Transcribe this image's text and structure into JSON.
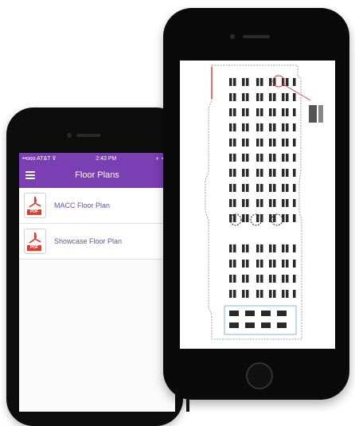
{
  "back_phone": {
    "status_bar": {
      "carrier": "••ooo AT&T ⊽",
      "time": "2:43 PM",
      "indicators": "◐ ⊲ ✱"
    },
    "nav": {
      "title": "Floor Plans",
      "menu_icon": "hamburger-icon"
    },
    "items": [
      {
        "label": "MACC Floor Plan",
        "icon": "pdf-icon",
        "tag": "PDF"
      },
      {
        "label": "Showcase Floor Plan",
        "icon": "pdf-icon",
        "tag": "PDF"
      }
    ]
  },
  "front_phone": {
    "content": "floor-plan-drawing"
  },
  "colors": {
    "purple": "#7a3fb2",
    "pdf_red": "#e23b2e",
    "booth_dark": "#2a2a2a",
    "highlight_blue": "#7bbbe0",
    "marker_red": "#d9302c"
  }
}
